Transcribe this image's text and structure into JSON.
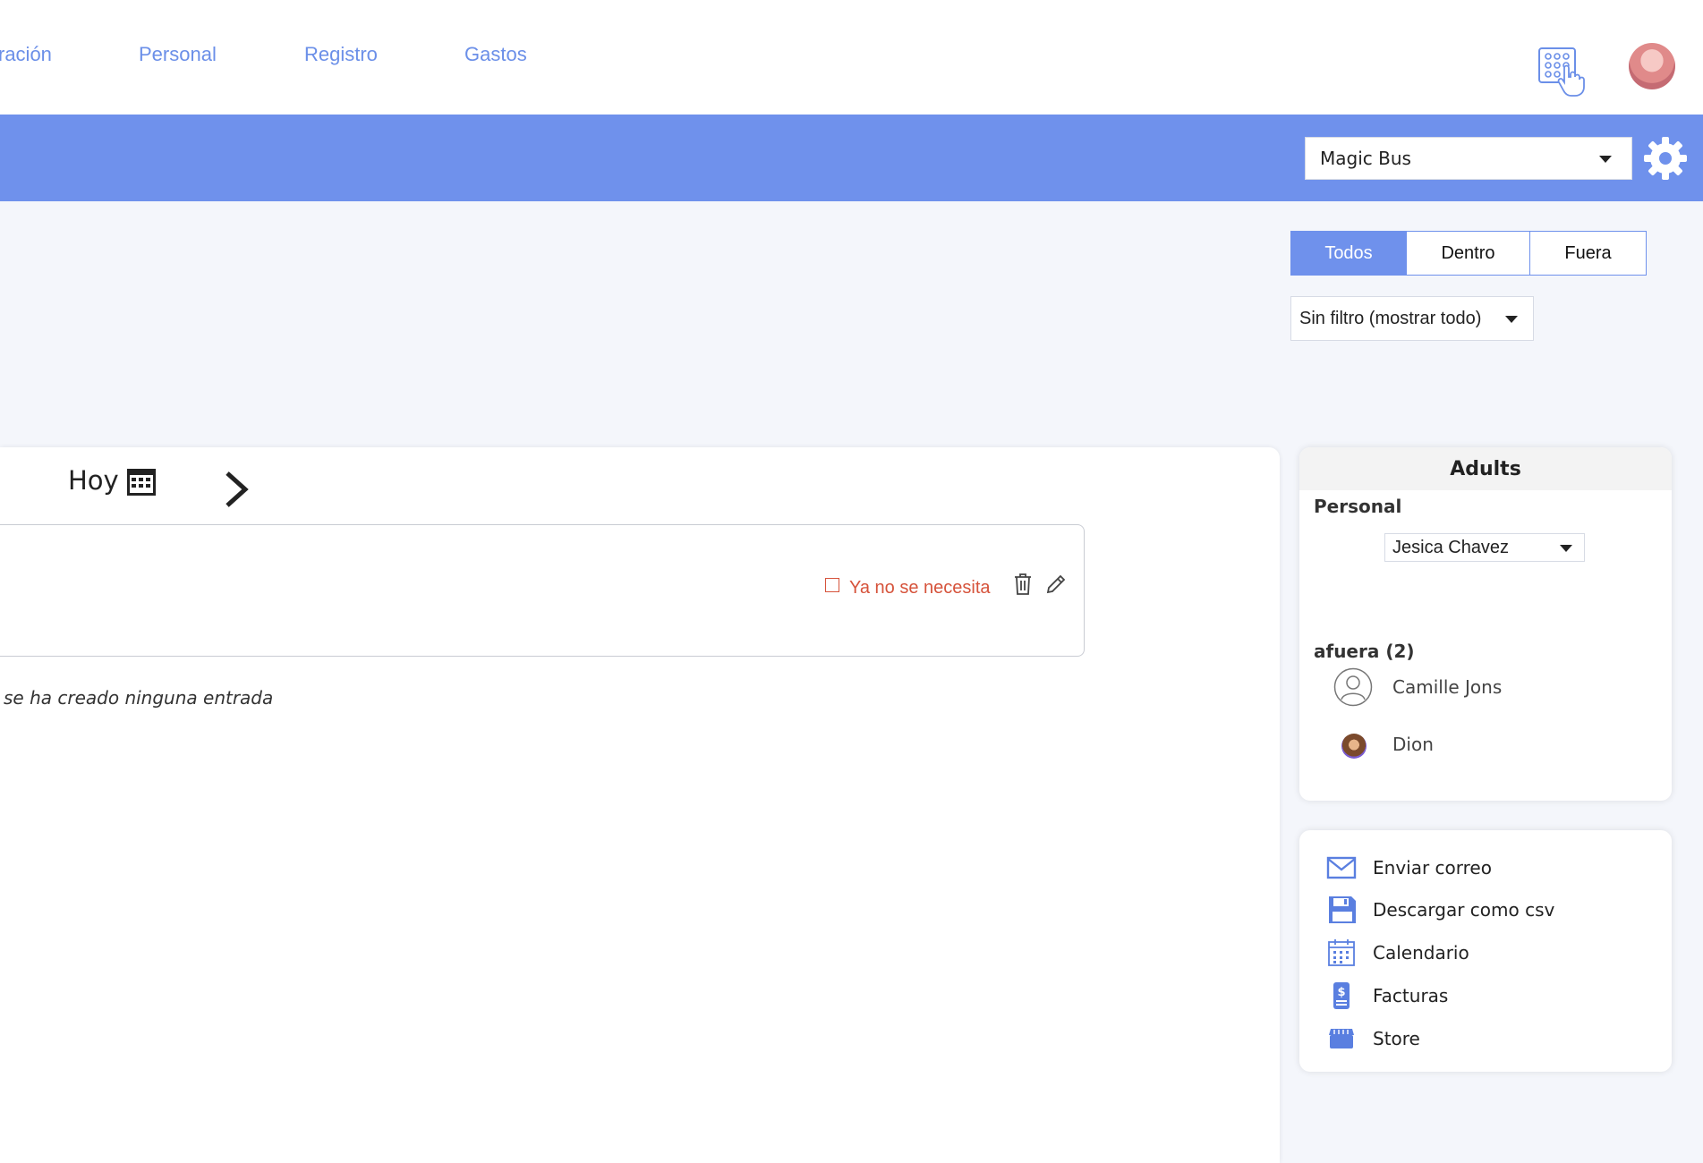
{
  "nav": {
    "items": [
      "ración",
      "Personal",
      "Registro",
      "Gastos"
    ]
  },
  "header": {
    "org_selected": "Magic Bus"
  },
  "segments": [
    "Todos",
    "Dentro",
    "Fuera"
  ],
  "filter": {
    "selected": "Sin filtro (mostrar todo)"
  },
  "date_nav": {
    "today_label": "Hoy"
  },
  "entry": {
    "no_longer_needed": "Ya no se necesita"
  },
  "empty_message": "se ha creado ninguna entrada",
  "adults": {
    "title": "Adults",
    "personal_label": "Personal",
    "staff_selected": "Jesica Chavez",
    "outside_label": "afuera (2)",
    "people": [
      "Camille Jons",
      "Dion"
    ]
  },
  "actions": [
    "Enviar correo",
    "Descargar como csv",
    "Calendario",
    "Facturas",
    "Store"
  ],
  "colors": {
    "accent": "#6f91ec",
    "nav_link": "#6b8fe8",
    "warning": "#d6533b"
  }
}
